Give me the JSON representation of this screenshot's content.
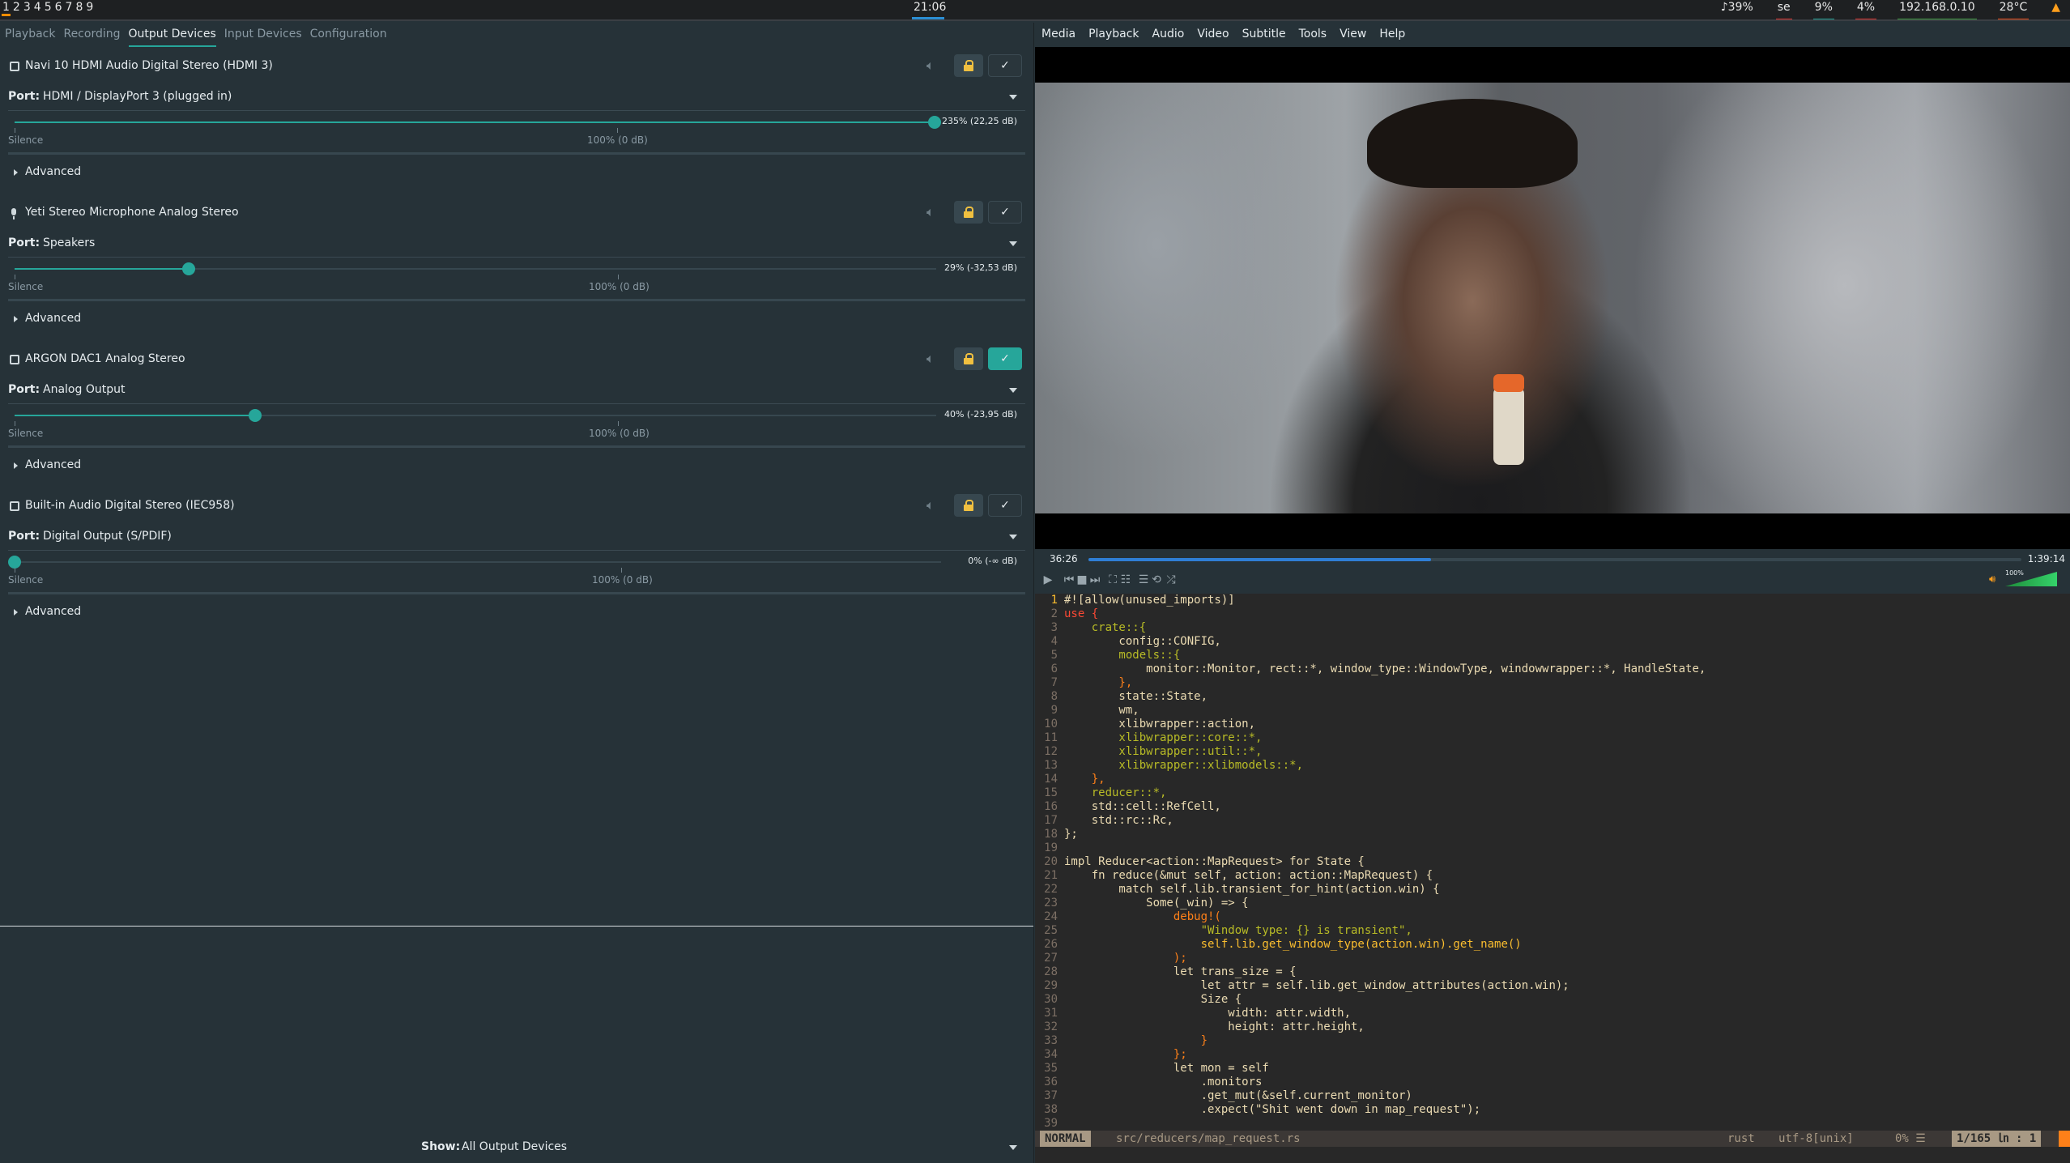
{
  "topbar": {
    "workspaces": [
      "1",
      "2",
      "3",
      "4",
      "5",
      "6",
      "7",
      "8",
      "9"
    ],
    "active_workspace": "1",
    "clock": "21:06",
    "volume": "39%",
    "layout": "se",
    "cpu": "9%",
    "mem": "4%",
    "ip": "192.168.0.10",
    "temp": "28°C",
    "colors": {
      "accent": "#ff8c00",
      "clock_bar": "#2b8ed4",
      "cpu_bar": "#26a69a",
      "mem_bar": "#e53935",
      "ip_bar": "#43a047",
      "temp_bar": "#f4511e"
    }
  },
  "pavucontrol": {
    "tabs": [
      {
        "label": "Playback",
        "active": false
      },
      {
        "label": "Recording",
        "active": false
      },
      {
        "label": "Output Devices",
        "active": true
      },
      {
        "label": "Input Devices",
        "active": false
      },
      {
        "label": "Configuration",
        "active": false
      }
    ],
    "port_label": "Port:",
    "silence_label": "Silence",
    "advanced_label": "Advanced",
    "devices": [
      {
        "name": "Navi 10 HDMI Audio Digital Stereo (HDMI 3)",
        "icon": "hdmi-icon",
        "port": "HDMI / DisplayPort 3 (plugged in)",
        "volume_text": "235% (22,25 dB)",
        "volume_fraction": 1.0,
        "reference": "100% (0 dB)",
        "default": false
      },
      {
        "name": "Yeti Stereo Microphone Analog Stereo",
        "icon": "microphone-icon",
        "port": "Speakers",
        "volume_text": "29% (-32,53 dB)",
        "volume_fraction": 0.189,
        "reference": "100% (0 dB)",
        "default": false
      },
      {
        "name": "ARGON DAC1 Analog Stereo",
        "icon": "sound-card-icon",
        "port": "Analog Output",
        "volume_text": "40% (-23,95 dB)",
        "volume_fraction": 0.261,
        "reference": "100% (0 dB)",
        "default": true
      },
      {
        "name": "Built-in Audio Digital Stereo (IEC958)",
        "icon": "sound-card-icon",
        "port": "Digital Output (S/PDIF)",
        "volume_text": "0% (-∞ dB)",
        "volume_fraction": 0.0,
        "reference": "100% (0 dB)",
        "default": false
      }
    ],
    "show_label": "Show:",
    "show_value": "All Output Devices"
  },
  "vlc": {
    "menu": [
      "Media",
      "Playback",
      "Audio",
      "Video",
      "Subtitle",
      "Tools",
      "View",
      "Help"
    ],
    "time_current": "36:26",
    "time_total": "1:39:14",
    "progress_fraction": 0.367,
    "volume_label": "100%",
    "controls": [
      "play-icon",
      "previous-icon",
      "stop-icon",
      "next-icon",
      "fullscreen-icon",
      "equalizer-icon",
      "playlist-icon",
      "loop-icon",
      "shuffle-icon"
    ]
  },
  "vim": {
    "lines": [
      {
        "n": "1",
        "t": "#![allow(unused_imports)]",
        "c": ""
      },
      {
        "n": "2",
        "t": "use {",
        "c": "kw"
      },
      {
        "n": "3",
        "t": "    crate::{",
        "c": "path"
      },
      {
        "n": "4",
        "t": "        config::CONFIG,",
        "c": ""
      },
      {
        "n": "5",
        "t": "        models::{",
        "c": "path"
      },
      {
        "n": "6",
        "t": "            monitor::Monitor, rect::*, window_type::WindowType, windowwrapper::*, HandleState,",
        "c": ""
      },
      {
        "n": "7",
        "t": "        },",
        "c": "punc"
      },
      {
        "n": "8",
        "t": "        state::State,",
        "c": ""
      },
      {
        "n": "9",
        "t": "        wm,",
        "c": ""
      },
      {
        "n": "10",
        "t": "        xlibwrapper::action,",
        "c": ""
      },
      {
        "n": "11",
        "t": "        xlibwrapper::core::*,",
        "c": "path"
      },
      {
        "n": "12",
        "t": "        xlibwrapper::util::*,",
        "c": "path"
      },
      {
        "n": "13",
        "t": "        xlibwrapper::xlibmodels::*,",
        "c": "path"
      },
      {
        "n": "14",
        "t": "    },",
        "c": "punc"
      },
      {
        "n": "15",
        "t": "    reducer::*,",
        "c": "path"
      },
      {
        "n": "16",
        "t": "    std::cell::RefCell,",
        "c": ""
      },
      {
        "n": "17",
        "t": "    std::rc::Rc,",
        "c": ""
      },
      {
        "n": "18",
        "t": "};",
        "c": ""
      },
      {
        "n": "19",
        "t": "",
        "c": ""
      },
      {
        "n": "20",
        "t": "impl Reducer<action::MapRequest> for State {",
        "c": ""
      },
      {
        "n": "21",
        "t": "    fn reduce(&mut self, action: action::MapRequest) {",
        "c": ""
      },
      {
        "n": "22",
        "t": "        match self.lib.transient_for_hint(action.win) {",
        "c": ""
      },
      {
        "n": "23",
        "t": "            Some(_win) => {",
        "c": ""
      },
      {
        "n": "24",
        "t": "                debug!(",
        "c": "punc"
      },
      {
        "n": "25",
        "t": "                    \"Window type: {} is transient\",",
        "c": "str"
      },
      {
        "n": "26",
        "t": "                    self.lib.get_window_type(action.win).get_name()",
        "c": "fn"
      },
      {
        "n": "27",
        "t": "                );",
        "c": "punc"
      },
      {
        "n": "28",
        "t": "                let trans_size = {",
        "c": ""
      },
      {
        "n": "29",
        "t": "                    let attr = self.lib.get_window_attributes(action.win);",
        "c": ""
      },
      {
        "n": "30",
        "t": "                    Size {",
        "c": ""
      },
      {
        "n": "31",
        "t": "                        width: attr.width,",
        "c": ""
      },
      {
        "n": "32",
        "t": "                        height: attr.height,",
        "c": ""
      },
      {
        "n": "33",
        "t": "                    }",
        "c": "punc"
      },
      {
        "n": "34",
        "t": "                };",
        "c": "punc"
      },
      {
        "n": "35",
        "t": "                let mon = self",
        "c": ""
      },
      {
        "n": "36",
        "t": "                    .monitors",
        "c": ""
      },
      {
        "n": "37",
        "t": "                    .get_mut(&self.current_monitor)",
        "c": ""
      },
      {
        "n": "38",
        "t": "                    .expect(\"Shit went down in map_request\");",
        "c": ""
      },
      {
        "n": "39",
        "t": "",
        "c": ""
      }
    ],
    "status": {
      "mode": "NORMAL",
      "file": "src/reducers/map_request.rs",
      "filetype": "rust",
      "encoding": "utf-8[unix]",
      "percent": "0% ☰",
      "position": "1/165 ㏑ :  1"
    }
  }
}
